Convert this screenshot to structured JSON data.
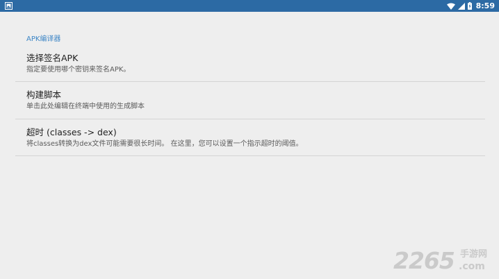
{
  "statusbar": {
    "time": "8:59",
    "left_icon": "notification-image-icon",
    "icons": [
      "wifi-icon",
      "cell-signal-icon",
      "battery-charging-icon"
    ]
  },
  "settings": {
    "category": "APK编译器",
    "items": [
      {
        "title": "选择签名APK",
        "summary": "指定要使用哪个密钥来签名APK。"
      },
      {
        "title": "构建脚本",
        "summary": "单击此处编辑在终端中使用的生成脚本"
      },
      {
        "title": "超时 (classes -> dex)",
        "summary": "将classes转换为dex文件可能需要很长时间。 在这里，您可以设置一个指示超时的阈值。"
      }
    ]
  },
  "watermark": {
    "number": "2265",
    "cn": "手游网",
    "domain": ".com"
  },
  "colors": {
    "statusbar": "#2c6aa4",
    "accent": "#3d86c6",
    "background": "#eeeeee"
  }
}
